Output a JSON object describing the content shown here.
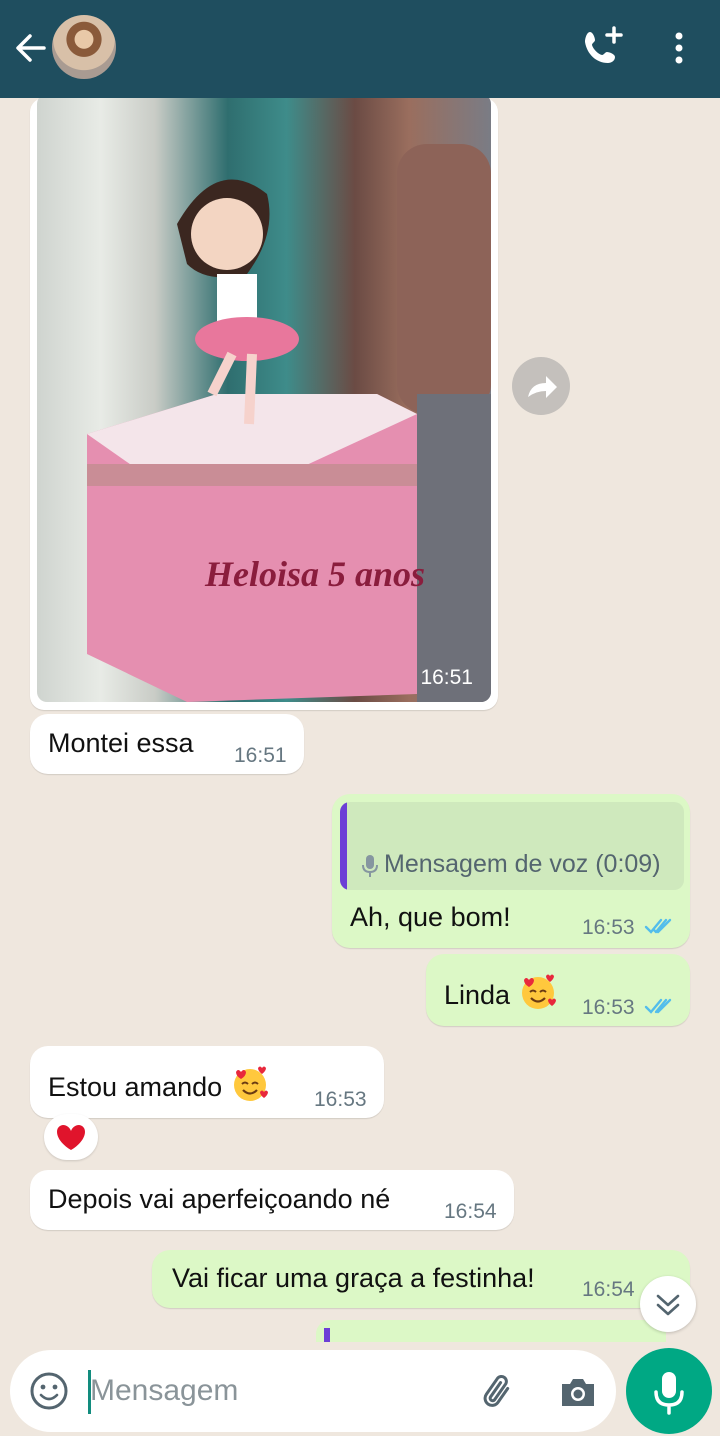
{
  "header": {
    "back_icon": "arrow-left-icon",
    "call_icon": "add-call-icon",
    "menu_icon": "more-vertical-icon",
    "bg_color": "#1f4e5f"
  },
  "messages": [
    {
      "id": "m1",
      "type": "image",
      "direction": "in",
      "time": "16:51",
      "image_text": "Heloisa 5 anos"
    },
    {
      "id": "m2",
      "type": "text",
      "direction": "in",
      "text": "Montei essa",
      "time": "16:51"
    },
    {
      "id": "m3",
      "type": "reply",
      "direction": "out",
      "quoted": "Mensagem de voz (0:09)",
      "text": "Ah, que bom!",
      "time": "16:53",
      "status": "read"
    },
    {
      "id": "m4",
      "type": "text",
      "direction": "out",
      "text": "Linda",
      "emoji": "smiling-face-with-hearts",
      "time": "16:53",
      "status": "read"
    },
    {
      "id": "m5",
      "type": "text",
      "direction": "in",
      "text": "Estou amando",
      "emoji": "smiling-face-with-hearts",
      "time": "16:53",
      "reaction": "❤️"
    },
    {
      "id": "m6",
      "type": "text",
      "direction": "in",
      "text": "Depois vai aperfeiçoando né",
      "time": "16:54"
    },
    {
      "id": "m7",
      "type": "text",
      "direction": "out",
      "text": "Vai ficar uma graça a festinha!",
      "time": "16:54",
      "status": "read"
    }
  ],
  "input": {
    "placeholder": "Mensagem",
    "emoji_icon": "emoji-icon",
    "attach_icon": "paperclip-icon",
    "camera_icon": "camera-icon",
    "mic_icon": "mic-icon"
  },
  "colors": {
    "accent": "#00a884",
    "outgoing_bubble": "#dcf8c6",
    "incoming_bubble": "#ffffff",
    "read_ticks": "#53bdeb",
    "quote_bar": "#6c3fd6"
  }
}
